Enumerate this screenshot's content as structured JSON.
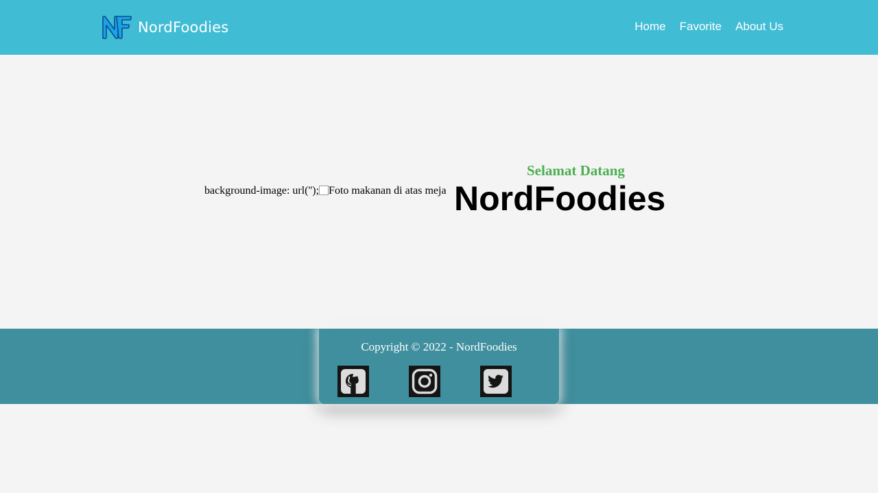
{
  "navbar": {
    "brand_name": "NordFoodies",
    "logo_icon": "nf-logo-icon",
    "links": [
      {
        "label": "Home"
      },
      {
        "label": "Favorite"
      },
      {
        "label": "About Us"
      }
    ],
    "background_color": "#40bcd5"
  },
  "hero": {
    "image_fallback_prefix": "background-image: url('');",
    "image_alt": "Foto makanan di atas meja",
    "subtitle": "Selamat Datang",
    "title": "NordFoodies",
    "subtitle_color": "#4caf50"
  },
  "footer": {
    "copyright": "Copyright © 2022 - NordFoodies",
    "background_color": "#3f8f9e",
    "social_links": [
      {
        "icon": "github-icon"
      },
      {
        "icon": "instagram-icon"
      },
      {
        "icon": "twitter-icon"
      }
    ]
  }
}
